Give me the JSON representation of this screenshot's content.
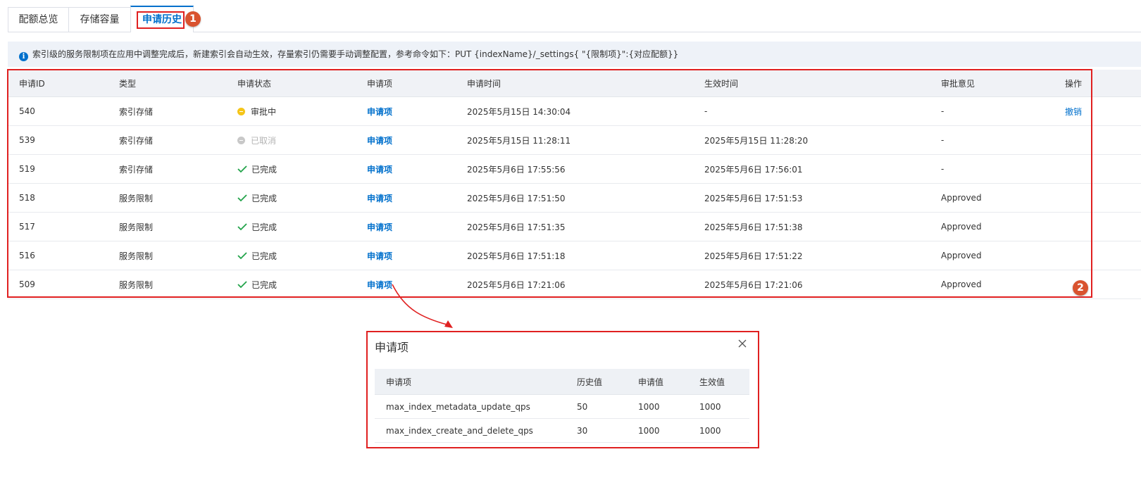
{
  "tabs": [
    {
      "label": "配额总览"
    },
    {
      "label": "存储容量"
    },
    {
      "label": "申请历史",
      "active": true
    }
  ],
  "annotations": {
    "badge1": "1",
    "badge2": "2"
  },
  "notice": {
    "icon": "info-icon",
    "text": "索引级的服务限制项在应用中调整完成后，新建索引会自动生效，存量索引仍需要手动调整配置，参考命令如下：PUT {indexName}/_settings{ \"{限制项}\":{对应配额}}"
  },
  "table": {
    "headers": [
      "申请ID",
      "类型",
      "申请状态",
      "申请项",
      "申请时间",
      "生效时间",
      "审批意见",
      "操作"
    ],
    "rows": [
      {
        "id": "540",
        "type": "索引存储",
        "status": "审批中",
        "status_kind": "pending",
        "item": "申请项",
        "apply_time": "2025年5月15日 14:30:04",
        "effect_time": "-",
        "opinion": "-",
        "action": "撤销"
      },
      {
        "id": "539",
        "type": "索引存储",
        "status": "已取消",
        "status_kind": "cancelled",
        "item": "申请项",
        "apply_time": "2025年5月15日 11:28:11",
        "effect_time": "2025年5月15日 11:28:20",
        "opinion": "-",
        "action": ""
      },
      {
        "id": "519",
        "type": "索引存储",
        "status": "已完成",
        "status_kind": "done",
        "item": "申请项",
        "apply_time": "2025年5月6日 17:55:56",
        "effect_time": "2025年5月6日 17:56:01",
        "opinion": "-",
        "action": ""
      },
      {
        "id": "518",
        "type": "服务限制",
        "status": "已完成",
        "status_kind": "done",
        "item": "申请项",
        "apply_time": "2025年5月6日 17:51:50",
        "effect_time": "2025年5月6日 17:51:53",
        "opinion": "Approved",
        "action": ""
      },
      {
        "id": "517",
        "type": "服务限制",
        "status": "已完成",
        "status_kind": "done",
        "item": "申请项",
        "apply_time": "2025年5月6日 17:51:35",
        "effect_time": "2025年5月6日 17:51:38",
        "opinion": "Approved",
        "action": ""
      },
      {
        "id": "516",
        "type": "服务限制",
        "status": "已完成",
        "status_kind": "done",
        "item": "申请项",
        "apply_time": "2025年5月6日 17:51:18",
        "effect_time": "2025年5月6日 17:51:22",
        "opinion": "Approved",
        "action": ""
      },
      {
        "id": "509",
        "type": "服务限制",
        "status": "已完成",
        "status_kind": "done",
        "item": "申请项",
        "apply_time": "2025年5月6日 17:21:06",
        "effect_time": "2025年5月6日 17:21:06",
        "opinion": "Approved",
        "action": ""
      }
    ]
  },
  "modal": {
    "title": "申请项",
    "headers": [
      "申请项",
      "历史值",
      "申请值",
      "生效值"
    ],
    "rows": [
      {
        "item": "max_index_metadata_update_qps",
        "history": "50",
        "apply": "1000",
        "effect": "1000"
      },
      {
        "item": "max_index_create_and_delete_qps",
        "history": "30",
        "apply": "1000",
        "effect": "1000"
      }
    ]
  },
  "colors": {
    "accent": "#0070cc",
    "highlight": "#e02020",
    "badge": "#d9532f",
    "pending": "#f5c518",
    "done": "#22a34a"
  }
}
